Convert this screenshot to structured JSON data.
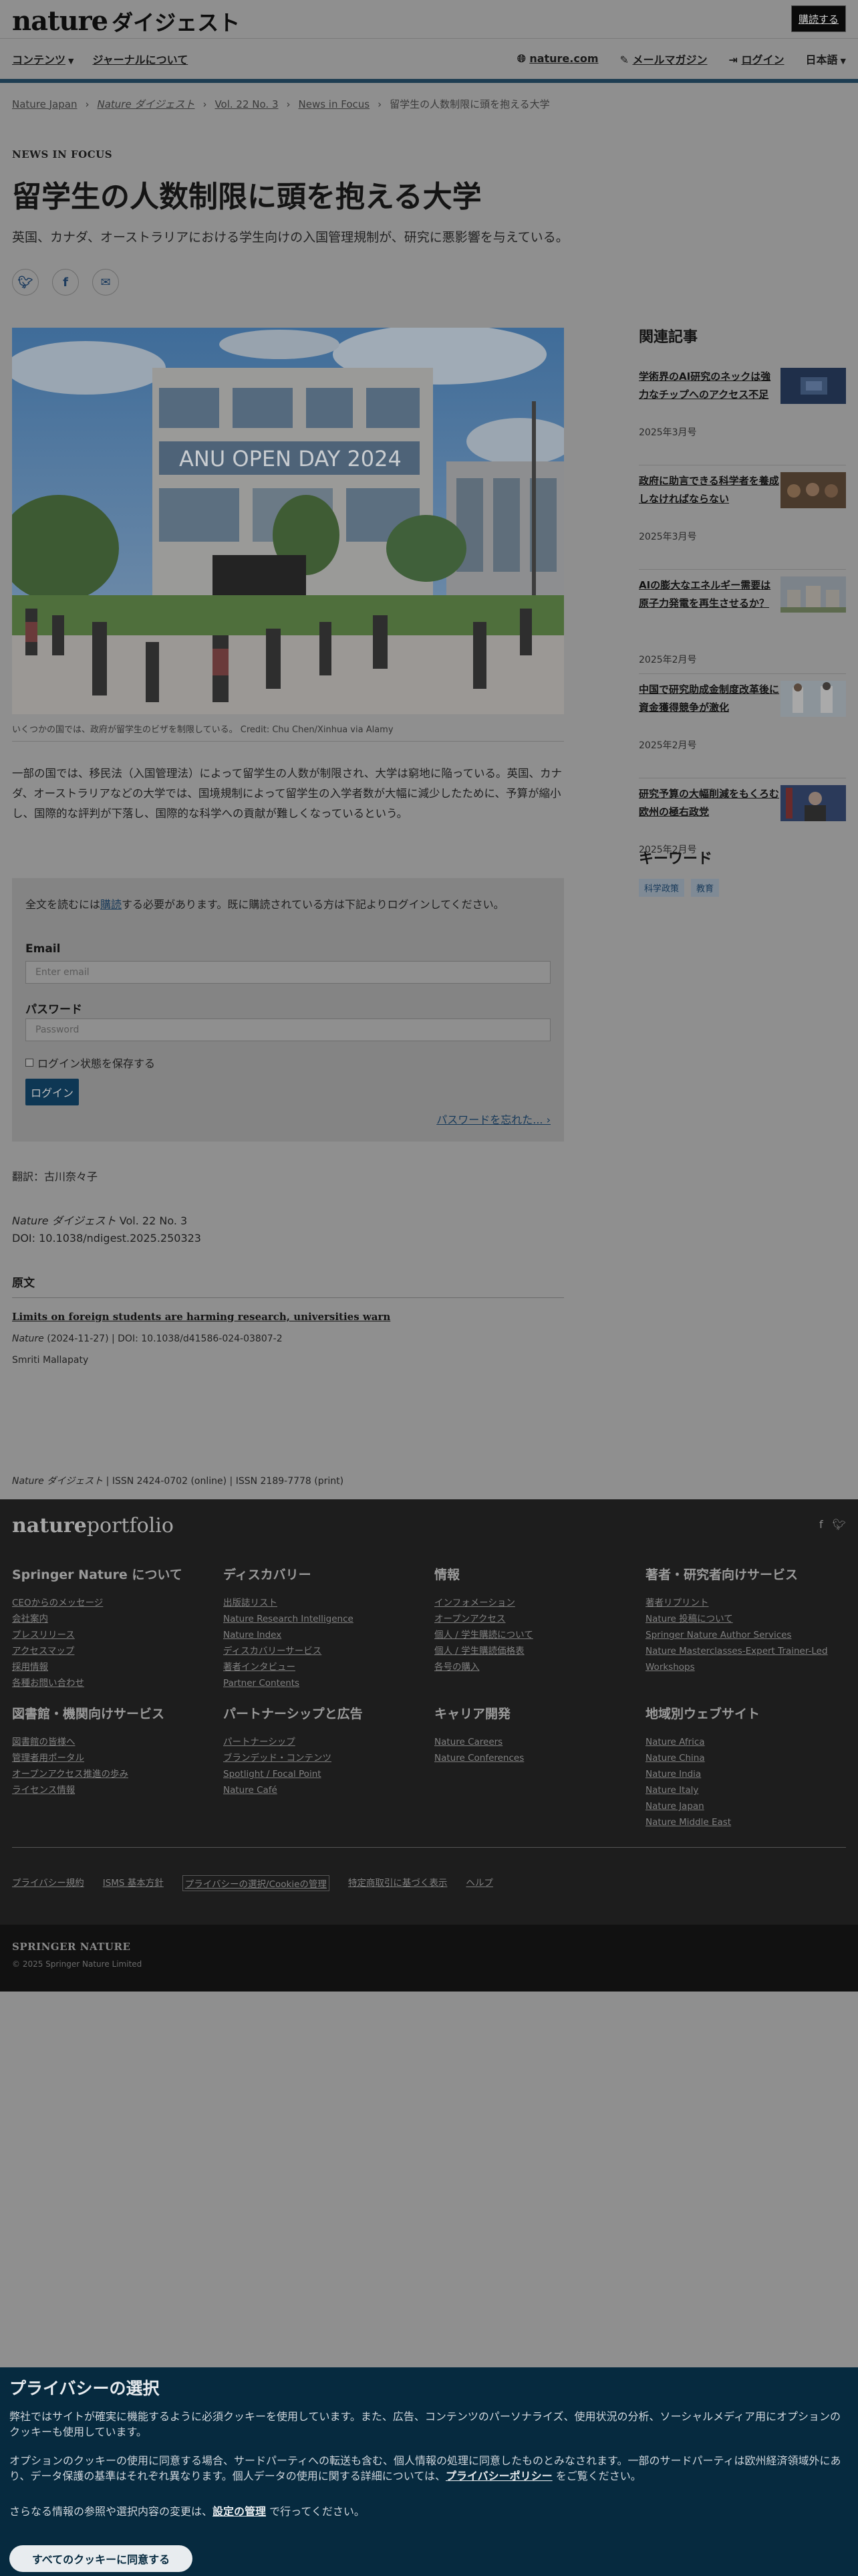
{
  "header": {
    "logo": "nature",
    "logo_jp": "ダイジェスト",
    "subscribe": "購読する",
    "nav_left": [
      "コンテンツ",
      "ジャーナルについて"
    ],
    "nav_right": {
      "site": "nature.com",
      "mail": "メールマガジン",
      "login": "ログイン",
      "lang": "日本語"
    }
  },
  "breadcrumb": [
    "Nature Japan",
    "Nature ダイジェスト",
    "Vol. 22 No. 3",
    "News in Focus",
    "留学生の人数制限に頭を抱える大学"
  ],
  "article": {
    "kicker": "NEWS IN FOCUS",
    "title": "留学生の人数制限に頭を抱える大学",
    "standfirst": "英国、カナダ、オーストラリアにおける学生向けの入国管理規制が、研究に悪影響を与えている。",
    "share": [
      "twitter-icon",
      "facebook-icon",
      "email-icon"
    ],
    "hero_sign": "ANU OPEN DAY 2024",
    "caption": "いくつかの国では、政府が留学生のビザを制限している。 Credit: Chu Chen/Xinhua via Alamy",
    "body": "一部の国では、移民法（入国管理法）によって留学生の人数が制限され、大学は窮地に陥っている。英国、カナダ、オーストラリアなどの大学では、国境規制によって留学生の入学者数が大幅に減少したために、予算が縮小し、国際的な評判が下落し、国際的な科学への貢献が難しくなっているという。"
  },
  "login": {
    "intro_pre": "全文を読むには",
    "intro_link": "購読",
    "intro_post": "する必要があります。既に購読されている方は下記よりログインしてください。",
    "email_label": "Email",
    "email_placeholder": "Enter email",
    "password_label": "パスワード",
    "password_placeholder": "Password",
    "remember": "ログイン状態を保存する",
    "button": "ログイン",
    "forgot": "パスワードを忘れた..."
  },
  "meta": {
    "translator": "翻訳：古川奈々子",
    "journal": "Nature ダイジェスト",
    "volume": "Vol. 22 No. 3",
    "doi": "DOI: 10.1038/ndigest.2025.250323",
    "original_heading": "原文",
    "original_title": "Limits on foreign students are harming research, universities warn",
    "original_journal": "Nature",
    "original_meta": "(2024-11-27) | DOI: 10.1038/d41586-024-03807-2",
    "author": "Smriti Mallapaty",
    "issn_journal": "Nature ダイジェスト",
    "issn": "ISSN 2424-0702 (online) | ISSN 2189-7778 (print)"
  },
  "sidebar": {
    "related_heading": "関連記事",
    "related": [
      {
        "title": "学術界のAI研究のネックは強力なチップへのアクセス不足",
        "date": "2025年3月号"
      },
      {
        "title": "政府に助言できる科学者を養成しなければならない",
        "date": "2025年3月号"
      },
      {
        "title": "AIの膨大なエネルギー需要は原子力発電を再生させるか？",
        "date": "2025年2月号"
      },
      {
        "title": "中国で研究助成金制度改革後に資金獲得競争が激化",
        "date": "2025年2月号"
      },
      {
        "title": "研究予算の大幅削減をもくろむ欧州の極右政党",
        "date": "2025年2月号"
      }
    ],
    "keywords_heading": "キーワード",
    "keywords": [
      "科学政策",
      "教育"
    ]
  },
  "footer": {
    "logo_a": "nature",
    "logo_b": "portfolio",
    "columns": [
      {
        "heading": "Springer Nature について",
        "links": [
          "CEOからのメッセージ",
          "会社案内",
          "プレスリリース",
          "アクセスマップ",
          "採用情報",
          "各種お問い合わせ"
        ]
      },
      {
        "heading": "ディスカバリー",
        "links": [
          "出版誌リスト",
          "Nature Research Intelligence",
          "Nature Index",
          "ディスカバリーサービス",
          "著者インタビュー",
          "Partner Contents"
        ]
      },
      {
        "heading": "情報",
        "links": [
          "インフォメーション",
          "オープンアクセス",
          "個人 / 学生購読について",
          "個人 / 学生購読価格表",
          "各号の購入"
        ]
      },
      {
        "heading": "著者・研究者向けサービス",
        "links": [
          "著者リプリント",
          "Nature 投稿について",
          "Springer Nature Author Services",
          "Nature Masterclasses-Expert Trainer-Led Workshops"
        ]
      },
      {
        "heading": "図書館・機関向けサービス",
        "links": [
          "図書館の皆様へ",
          "管理者用ポータル",
          "オープンアクセス推進の歩み",
          "ライセンス情報"
        ]
      },
      {
        "heading": "パートナーシップと広告",
        "links": [
          "パートナーシップ",
          "ブランデッド・コンテンツ",
          "Spotlight / Focal Point",
          "Nature Café"
        ]
      },
      {
        "heading": "キャリア開発",
        "links": [
          "Nature Careers",
          "Nature Conferences"
        ]
      },
      {
        "heading": "地域別ウェブサイト",
        "links": [
          "Nature Africa",
          "Nature China",
          "Nature India",
          "Nature Italy",
          "Nature Japan",
          "Nature Middle East"
        ]
      }
    ],
    "legal": [
      "プライバシー規約",
      "ISMS 基本方針",
      "プライバシーの選択/Cookieの管理",
      "特定商取引に基づく表示",
      "ヘルプ"
    ],
    "springer_logo": "SPRINGER NATURE",
    "copyright": "© 2025 Springer Nature Limited"
  },
  "cookie": {
    "title": "プライバシーの選択",
    "p1": "弊社ではサイトが確実に機能するように必須クッキーを使用しています。また、広告、コンテンツのパーソナライズ、使用状況の分析、ソーシャルメディア用にオプションのクッキーも使用しています。",
    "p2_pre": "オプションのクッキーの使用に同意する場合、サードパーティへの転送も含む、個人情報の処理に同意したものとみなされます。一部のサードパーティは欧州経済領域外にあり、データ保護の基準はそれぞれ異なります。個人データの使用に関する詳細については、",
    "p2_link": "プライバシーポリシー",
    "p2_post": " をご覧ください。",
    "p3_pre": "さらなる情報の参照や選択内容の変更は、",
    "p3_link": "設定の管理",
    "p3_post": " で行ってください。",
    "accept": "すべてのクッキーに同意する"
  }
}
